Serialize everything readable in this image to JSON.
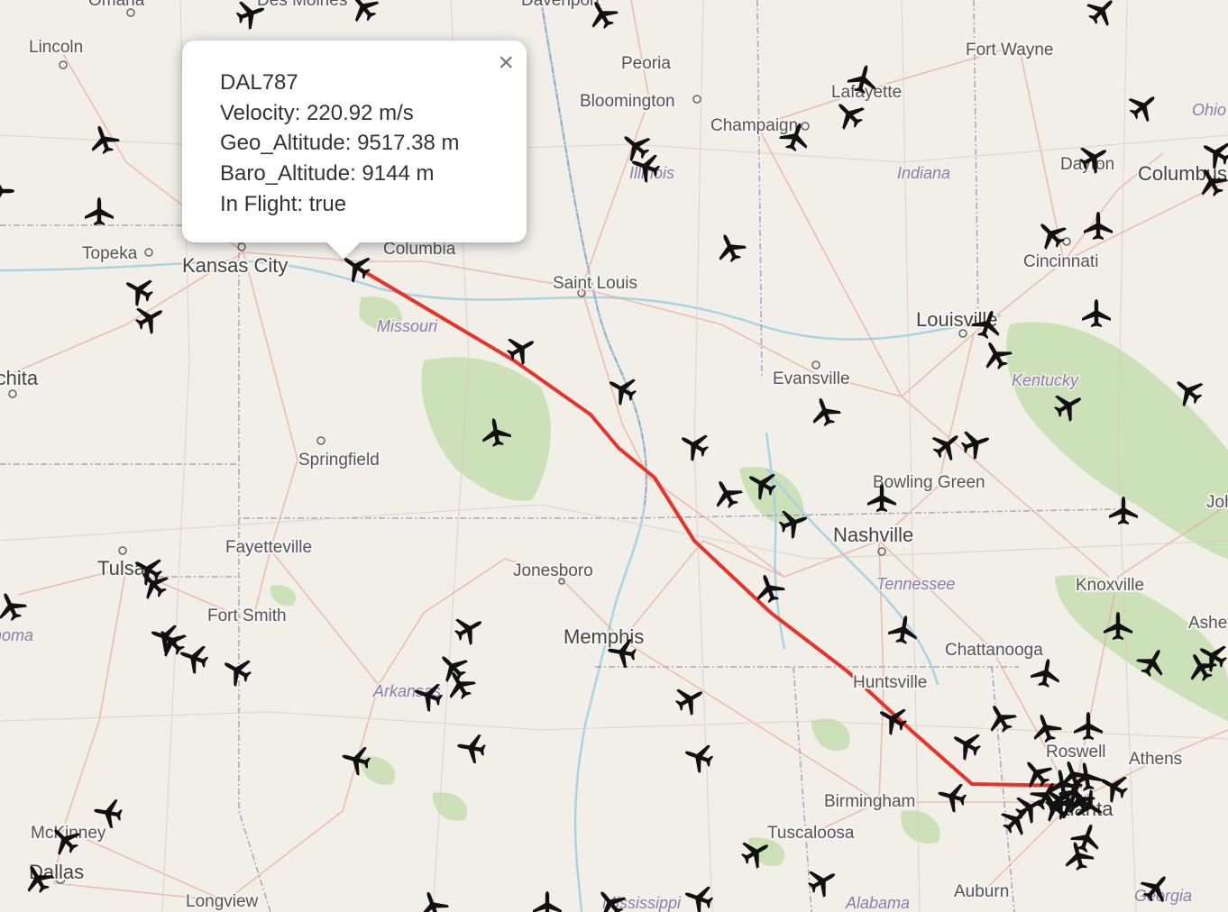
{
  "map": {
    "cities": [
      "Omaha",
      "Des Moines",
      "Davenport",
      "Lincoln",
      "Peoria",
      "Bloomington",
      "Champaign",
      "Lafayette",
      "Fort Wayne",
      "Dayton",
      "Columbus",
      "Topeka",
      "Kansas City",
      "Columbia",
      "Saint Louis",
      "Cincinnati",
      "Louisville",
      "Evansville",
      "Wichita",
      "Springfield",
      "Bowling Green",
      "Nashville",
      "Fayetteville",
      "Tulsa",
      "Jonesboro",
      "Knoxville",
      "Fort Smith",
      "Memphis",
      "Chattanooga",
      "Huntsville",
      "Roswell",
      "Athens",
      "Birmingham",
      "Tuscaloosa",
      "McKinney",
      "Dallas",
      "Longview",
      "Auburn",
      "Johnson City",
      "Asheville",
      "Atlanta"
    ],
    "states": [
      "Illinois",
      "Indiana",
      "Ohio",
      "Missouri",
      "Kentucky",
      "Tennessee",
      "Oklahoma",
      "Arkansas",
      "Alabama",
      "Mississippi",
      "Georgia"
    ],
    "colors": {
      "land": "#f2efe9",
      "route": "#e8332a",
      "forest": "#add19e",
      "road": "#e8a79c",
      "border": "#9b8fa8"
    },
    "aircraft_icon": "airplane-icon"
  },
  "popup": {
    "callsign": "DAL787",
    "velocity": "Velocity: 220.92 m/s",
    "geo_altitude": "Geo_Altitude: 9517.38 m",
    "baro_altitude": "Baro_Altitude: 9144 m",
    "in_flight": "In Flight: true",
    "close_label": "×"
  }
}
